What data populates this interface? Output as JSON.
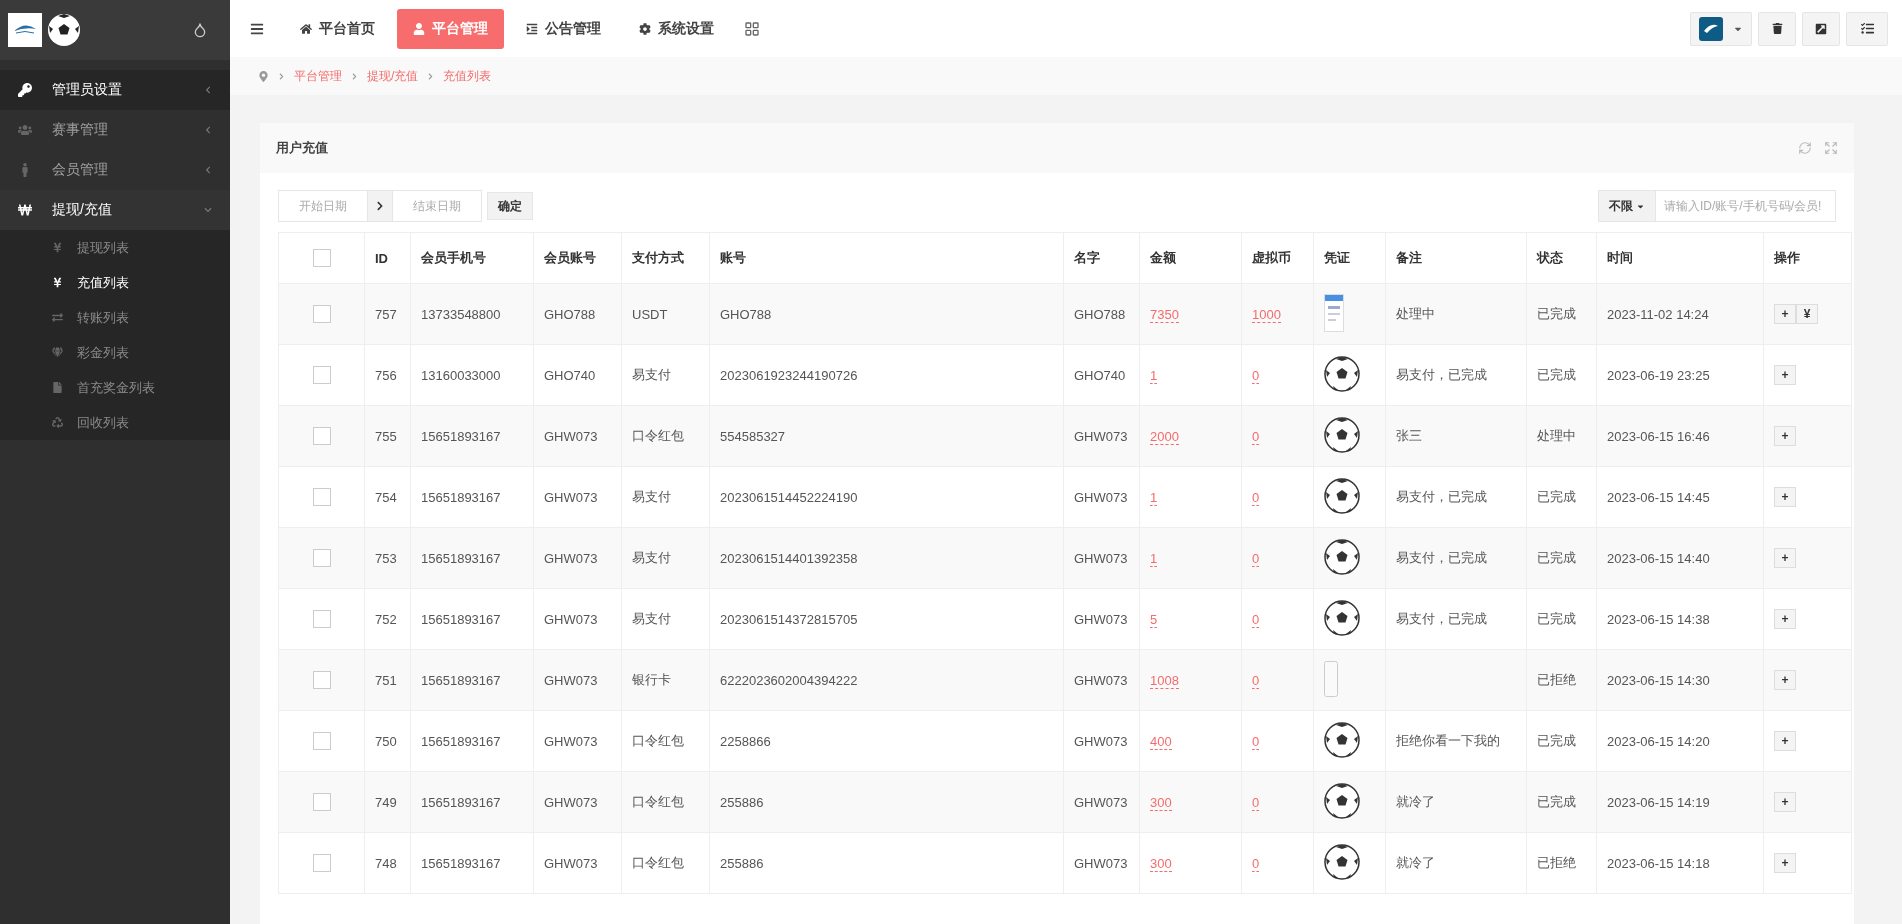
{
  "sidebar": {
    "items": [
      {
        "label": "管理员设置",
        "expanded": false,
        "selected": true
      },
      {
        "label": "赛事管理",
        "expanded": false,
        "selected": false
      },
      {
        "label": "会员管理",
        "expanded": false,
        "selected": false
      },
      {
        "label": "提现/充值",
        "expanded": true,
        "selected": false,
        "children": [
          {
            "label": "提现列表",
            "selected": false
          },
          {
            "label": "充值列表",
            "selected": true
          },
          {
            "label": "转账列表",
            "selected": false
          },
          {
            "label": "彩金列表",
            "selected": false
          },
          {
            "label": "首充奖金列表",
            "selected": false
          },
          {
            "label": "回收列表",
            "selected": false
          }
        ]
      }
    ]
  },
  "nav": {
    "tabs": [
      {
        "label": "平台首页",
        "selected": false
      },
      {
        "label": "平台管理",
        "selected": true
      },
      {
        "label": "公告管理",
        "selected": false
      },
      {
        "label": "系统设置",
        "selected": false
      }
    ]
  },
  "breadcrumb": [
    "平台管理",
    "提现/充值",
    "充值列表"
  ],
  "panel": {
    "title": "用户充值",
    "filters": {
      "start_placeholder": "开始日期",
      "end_placeholder": "结束日期",
      "confirm": "确定",
      "scope": "不限",
      "search_placeholder": "请输入ID/账号/手机号码/会员!"
    },
    "table": {
      "all_checked": false,
      "columns": [
        "ID",
        "会员手机号",
        "会员账号",
        "支付方式",
        "账号",
        "名字",
        "金额",
        "虚拟币",
        "凭证",
        "备注",
        "状态",
        "时间",
        "操作"
      ],
      "rows": [
        {
          "kind": "document",
          "checked": false,
          "id": "757",
          "phone": "13733548800",
          "member": "GHO788",
          "pay": "USDT",
          "account": "GHO788",
          "name": "GHO788",
          "amount": "7350",
          "coin": "1000",
          "note": "处理中",
          "status": "已完成",
          "time": "2023-11-02 14:24",
          "actions": [
            "+",
            "¥"
          ]
        },
        {
          "kind": "ball",
          "checked": false,
          "id": "756",
          "phone": "13160033000",
          "member": "GHO740",
          "pay": "易支付",
          "account": "2023061923244190726",
          "name": "GHO740",
          "amount": "1",
          "coin": "0",
          "note": "易支付，已完成",
          "status": "已完成",
          "time": "2023-06-19 23:25",
          "actions": [
            "+"
          ]
        },
        {
          "kind": "ball",
          "checked": false,
          "id": "755",
          "phone": "15651893167",
          "member": "GHW073",
          "pay": "口令红包",
          "account": "554585327",
          "name": "GHW073",
          "amount": "2000",
          "coin": "0",
          "note": "张三",
          "status": "处理中",
          "time": "2023-06-15 16:46",
          "actions": [
            "+"
          ]
        },
        {
          "kind": "ball",
          "checked": false,
          "id": "754",
          "phone": "15651893167",
          "member": "GHW073",
          "pay": "易支付",
          "account": "2023061514452224190",
          "name": "GHW073",
          "amount": "1",
          "coin": "0",
          "note": "易支付，已完成",
          "status": "已完成",
          "time": "2023-06-15 14:45",
          "actions": [
            "+"
          ]
        },
        {
          "kind": "ball",
          "checked": false,
          "id": "753",
          "phone": "15651893167",
          "member": "GHW073",
          "pay": "易支付",
          "account": "2023061514401392358",
          "name": "GHW073",
          "amount": "1",
          "coin": "0",
          "note": "易支付，已完成",
          "status": "已完成",
          "time": "2023-06-15 14:40",
          "actions": [
            "+"
          ]
        },
        {
          "kind": "ball",
          "checked": false,
          "id": "752",
          "phone": "15651893167",
          "member": "GHW073",
          "pay": "易支付",
          "account": "2023061514372815705",
          "name": "GHW073",
          "amount": "5",
          "coin": "0",
          "note": "易支付，已完成",
          "status": "已完成",
          "time": "2023-06-15 14:38",
          "actions": [
            "+"
          ]
        },
        {
          "kind": "slip",
          "checked": false,
          "id": "751",
          "phone": "15651893167",
          "member": "GHW073",
          "pay": "银行卡",
          "account": "6222023602004394222",
          "name": "GHW073",
          "amount": "1008",
          "coin": "0",
          "status": "已拒绝",
          "time": "2023-06-15 14:30",
          "actions": [
            "+"
          ]
        },
        {
          "kind": "ball",
          "checked": false,
          "id": "750",
          "phone": "15651893167",
          "member": "GHW073",
          "pay": "口令红包",
          "account": "2258866",
          "name": "GHW073",
          "amount": "400",
          "coin": "0",
          "note": "拒绝你看一下我的",
          "status": "已完成",
          "time": "2023-06-15 14:20",
          "actions": [
            "+"
          ]
        },
        {
          "kind": "ball",
          "checked": false,
          "id": "749",
          "phone": "15651893167",
          "member": "GHW073",
          "pay": "口令红包",
          "account": "255886",
          "name": "GHW073",
          "amount": "300",
          "coin": "0",
          "note": "就冷了",
          "status": "已完成",
          "time": "2023-06-15 14:19",
          "actions": [
            "+"
          ]
        },
        {
          "kind": "ball",
          "checked": false,
          "id": "748",
          "phone": "15651893167",
          "member": "GHW073",
          "pay": "口令红包",
          "account": "255886",
          "name": "GHW073",
          "amount": "300",
          "coin": "0",
          "note": "就冷了",
          "status": "已拒绝",
          "time": "2023-06-15 14:18",
          "actions": [
            "+"
          ]
        }
      ]
    }
  }
}
